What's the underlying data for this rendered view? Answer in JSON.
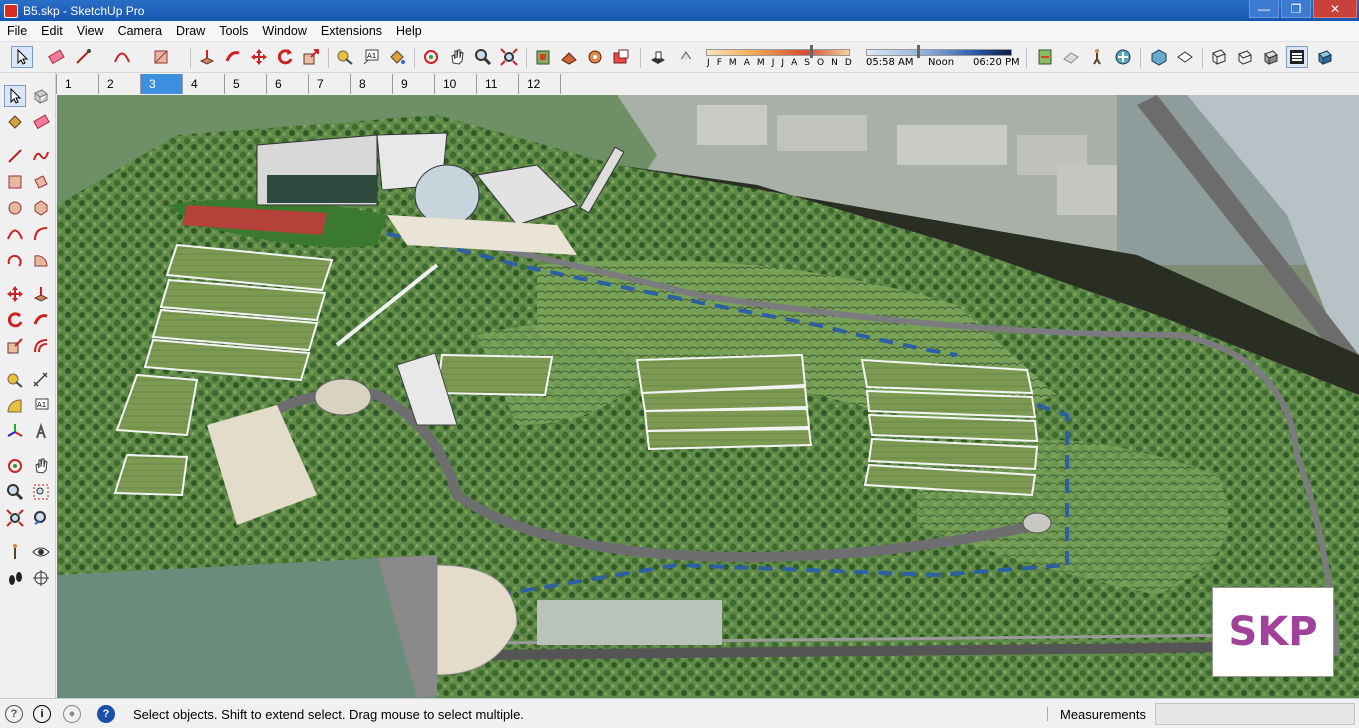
{
  "window": {
    "title": "B5.skp - SketchUp Pro",
    "minimize": "—",
    "maximize": "❐",
    "close": "✕"
  },
  "menu": [
    "File",
    "Edit",
    "View",
    "Camera",
    "Draw",
    "Tools",
    "Window",
    "Extensions",
    "Help"
  ],
  "shadow": {
    "months": [
      "J",
      "F",
      "M",
      "A",
      "M",
      "J",
      "J",
      "A",
      "S",
      "O",
      "N",
      "D"
    ],
    "month_position": 0.72,
    "time_start": "05:58 AM",
    "time_mid": "Noon",
    "time_end": "06:20 PM",
    "time_position": 0.35
  },
  "scene_tabs": [
    "1",
    "2",
    "3",
    "4",
    "5",
    "6",
    "7",
    "8",
    "9",
    "10",
    "11",
    "12"
  ],
  "active_scene": "3",
  "badge": "SKP",
  "status": {
    "message": "Select objects. Shift to extend select. Drag mouse to select multiple.",
    "measurements_label": "Measurements",
    "measurements_value": ""
  }
}
